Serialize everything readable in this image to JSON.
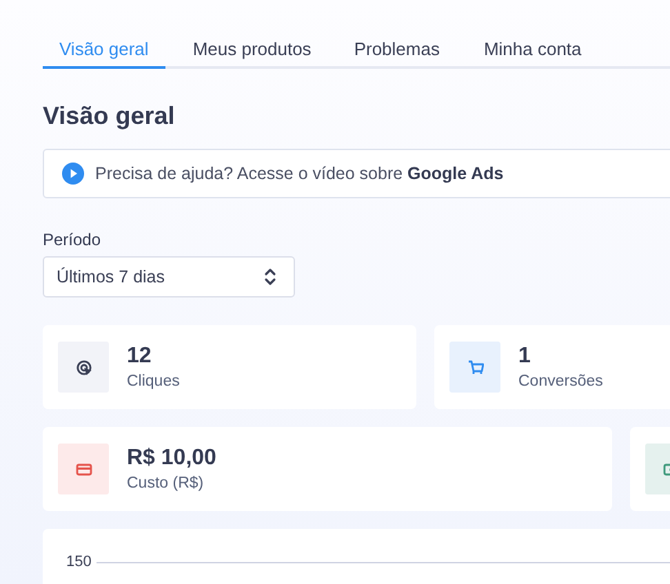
{
  "tabs": [
    {
      "label": "Visão geral",
      "selected": true
    },
    {
      "label": "Meus produtos",
      "selected": false
    },
    {
      "label": "Problemas",
      "selected": false
    },
    {
      "label": "Minha conta",
      "selected": false
    }
  ],
  "page_title": "Visão geral",
  "help_banner": {
    "text": "Precisa de ajuda? Acesse o vídeo sobre **Google Ads**"
  },
  "period": {
    "label": "Período",
    "value": "Últimos 7 dias"
  },
  "metric_rows": [
    {
      "metrics": [
        {
          "kind": "click",
          "color": "#3a3f55",
          "value": "12",
          "label": "Cliques"
        },
        {
          "kind": "cart",
          "color": "#2f8cf0",
          "value": "1",
          "label": "Conversões"
        }
      ]
    },
    {
      "metrics": [
        {
          "kind": "card",
          "color": "#e5534b",
          "value": "R$ 10,00",
          "label": "Custo (R$)"
        },
        {
          "kind": "money",
          "color": "#3f9a7c"
        }
      ]
    }
  ],
  "chart": {
    "y_tick_labels": [
      "150"
    ]
  }
}
